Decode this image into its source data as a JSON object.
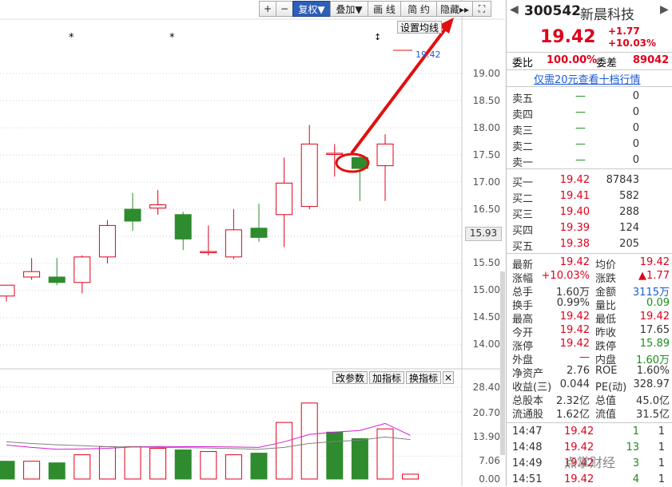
{
  "toolbar": {
    "buttons": [
      "+",
      "−",
      "复权▼",
      "叠加▼",
      "画 线",
      "简 约",
      "隐藏▸▸",
      "⛶"
    ]
  },
  "chart": {
    "price_axis": [
      "19.00",
      "18.50",
      "18.00",
      "17.50",
      "17.00",
      "16.50",
      "16.00",
      "15.50",
      "15.00",
      "14.50",
      "14.00"
    ],
    "current_price_marker": "15.93",
    "ma_button": "设置均线",
    "price_tag": "19.42",
    "volume_axis": [
      "28.40",
      "20.70",
      "13.90",
      "7.06",
      "0.00"
    ],
    "indicator_buttons": [
      "改参数",
      "加指标",
      "换指标",
      "×"
    ],
    "markers": [
      "*",
      "*",
      "↕"
    ]
  },
  "chart_data": {
    "type": "candlestick",
    "ylim": [
      13.6,
      19.3
    ],
    "candles": [
      {
        "o": 14.9,
        "c": 15.1,
        "h": 15.1,
        "l": 14.8
      },
      {
        "o": 15.25,
        "c": 15.35,
        "h": 15.6,
        "l": 15.2
      },
      {
        "o": 15.25,
        "c": 15.15,
        "h": 15.6,
        "l": 15.1
      },
      {
        "o": 15.15,
        "c": 15.62,
        "h": 15.65,
        "l": 14.95
      },
      {
        "o": 15.62,
        "c": 16.2,
        "h": 16.3,
        "l": 15.5
      },
      {
        "o": 16.5,
        "c": 16.28,
        "h": 16.8,
        "l": 16.1
      },
      {
        "o": 16.52,
        "c": 16.58,
        "h": 16.85,
        "l": 16.4
      },
      {
        "o": 16.4,
        "c": 15.95,
        "h": 16.45,
        "l": 15.75
      },
      {
        "o": 15.7,
        "c": 15.72,
        "h": 16.2,
        "l": 15.65
      },
      {
        "o": 15.62,
        "c": 16.12,
        "h": 16.5,
        "l": 15.58
      },
      {
        "o": 16.15,
        "c": 15.98,
        "h": 16.6,
        "l": 15.9
      },
      {
        "o": 16.4,
        "c": 16.98,
        "h": 17.45,
        "l": 15.8
      },
      {
        "o": 16.55,
        "c": 17.7,
        "h": 18.05,
        "l": 16.5
      },
      {
        "o": 17.52,
        "c": 17.53,
        "h": 17.7,
        "l": 17.1
      },
      {
        "o": 17.45,
        "c": 17.25,
        "h": 17.5,
        "l": 16.65
      },
      {
        "o": 17.3,
        "c": 17.7,
        "h": 17.88,
        "l": 16.65
      }
    ],
    "volume": {
      "ylim": [
        0,
        28.4
      ],
      "values": [
        5.5,
        5.5,
        5,
        7.5,
        10,
        10,
        9.5,
        9,
        8.5,
        7.5,
        8,
        17.5,
        23.5,
        14.5,
        12.5,
        15.5,
        1.5
      ],
      "up": [
        false,
        true,
        false,
        true,
        true,
        true,
        true,
        false,
        true,
        true,
        false,
        true,
        true,
        false,
        false,
        true,
        true
      ],
      "ma1": [
        10.5,
        9.8,
        9.2,
        9.3,
        9.5,
        9.9,
        10.1,
        10.0,
        10.0,
        9.9,
        9.8,
        11.5,
        13.8,
        14.5,
        15.0,
        17.2,
        13.5
      ],
      "ma2": [
        11.5,
        11.0,
        10.6,
        10.3,
        10.0,
        9.9,
        9.8,
        9.7,
        9.6,
        9.4,
        9.2,
        9.8,
        11.0,
        11.6,
        12.0,
        13.0,
        12.2
      ]
    }
  },
  "quote": {
    "code": "300542",
    "name": "新晨科技",
    "price": "19.42",
    "change": "+1.77",
    "change_pct": "+10.03%",
    "weibi_label": "委比",
    "weibi": "100.00%",
    "weicha_label": "委差",
    "weicha": "89042",
    "link": "仅需20元查看十档行情",
    "sells": [
      {
        "label": "卖五",
        "price": "—",
        "vol": "0"
      },
      {
        "label": "卖四",
        "price": "—",
        "vol": "0"
      },
      {
        "label": "卖三",
        "price": "—",
        "vol": "0"
      },
      {
        "label": "卖二",
        "price": "—",
        "vol": "0"
      },
      {
        "label": "卖一",
        "price": "—",
        "vol": "0"
      }
    ],
    "buys": [
      {
        "label": "买一",
        "price": "19.42",
        "vol": "87843"
      },
      {
        "label": "买二",
        "price": "19.41",
        "vol": "582"
      },
      {
        "label": "买三",
        "price": "19.40",
        "vol": "288"
      },
      {
        "label": "买四",
        "price": "19.39",
        "vol": "124"
      },
      {
        "label": "买五",
        "price": "19.38",
        "vol": "205"
      }
    ],
    "stats": [
      {
        "l1": "最新",
        "v1": "19.42",
        "c1": "red",
        "l2": "均价",
        "v2": "19.42",
        "c2": "red"
      },
      {
        "l1": "涨幅",
        "v1": "+10.03%",
        "c1": "red",
        "l2": "涨跌",
        "v2": "▲1.77",
        "c2": "red"
      },
      {
        "l1": "总手",
        "v1": "1.60万",
        "c1": "gray",
        "l2": "金额",
        "v2": "3115万",
        "c2": "blue"
      },
      {
        "l1": "换手",
        "v1": "0.99%",
        "c1": "gray",
        "l2": "量比",
        "v2": "0.09",
        "c2": "green"
      },
      {
        "l1": "最高",
        "v1": "19.42",
        "c1": "red",
        "l2": "最低",
        "v2": "19.42",
        "c2": "red"
      },
      {
        "l1": "今开",
        "v1": "19.42",
        "c1": "red",
        "l2": "昨收",
        "v2": "17.65",
        "c2": "gray"
      },
      {
        "l1": "涨停",
        "v1": "19.42",
        "c1": "red",
        "l2": "跌停",
        "v2": "15.89",
        "c2": "green"
      },
      {
        "l1": "外盘",
        "v1": "—",
        "c1": "red",
        "l2": "内盘",
        "v2": "1.60万",
        "c2": "green"
      },
      {
        "l1": "净资产",
        "v1": "2.76",
        "c1": "gray",
        "l2": "ROE",
        "v2": "1.60%",
        "c2": "gray"
      },
      {
        "l1": "收益(三)",
        "v1": "0.044",
        "c1": "gray",
        "l2": "PE(动)",
        "v2": "328.97",
        "c2": "gray"
      },
      {
        "l1": "总股本",
        "v1": "2.32亿",
        "c1": "gray",
        "l2": "总值",
        "v2": "45.0亿",
        "c2": "gray"
      },
      {
        "l1": "流通股",
        "v1": "1.62亿",
        "c1": "gray",
        "l2": "流值",
        "v2": "31.5亿",
        "c2": "gray"
      }
    ],
    "ticks": [
      {
        "time": "14:47",
        "price": "19.42",
        "vol": "1",
        "n": "1",
        "vc": "green"
      },
      {
        "time": "14:48",
        "price": "19.42",
        "vol": "13",
        "n": "1",
        "vc": "green"
      },
      {
        "time": "14:49",
        "price": "19.42",
        "vol": "3",
        "n": "1",
        "vc": "green"
      },
      {
        "time": "14:51",
        "price": "19.42",
        "vol": "4",
        "n": "1",
        "vc": "green"
      }
    ],
    "watermark": "点掌财经"
  },
  "colors": {
    "up": "#e0001b",
    "down": "#2e8b2e",
    "accent": "#2c5fb8"
  }
}
